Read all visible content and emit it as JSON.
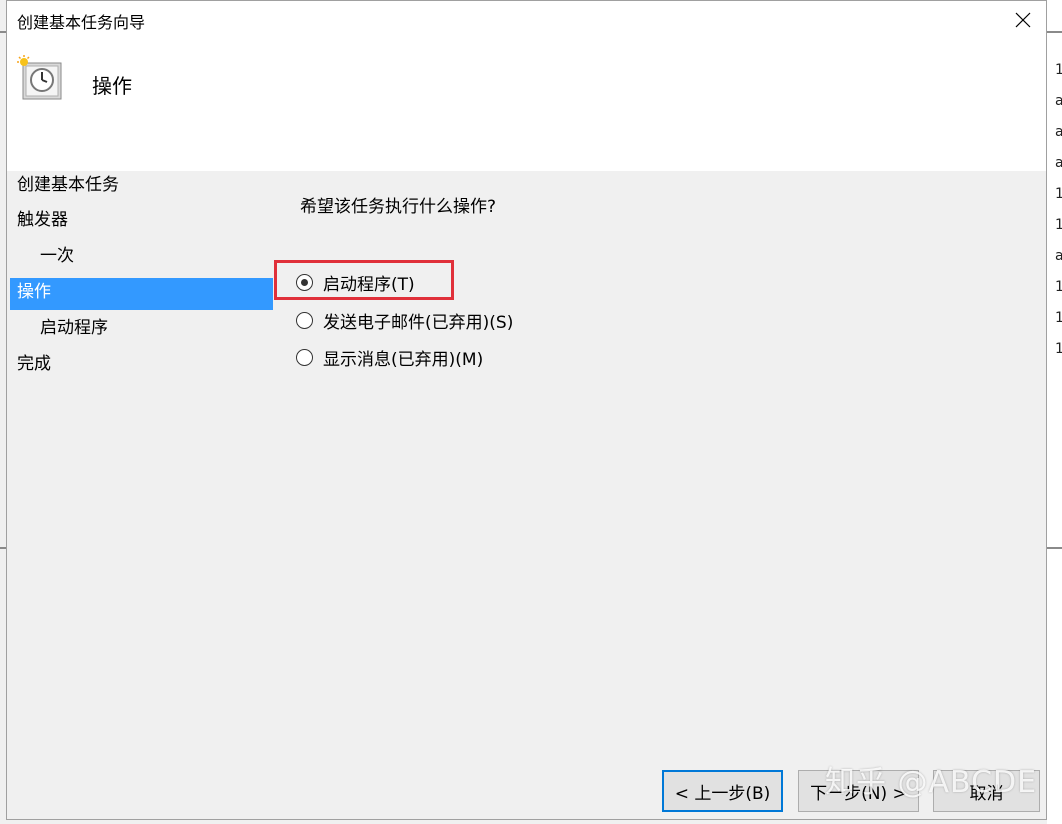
{
  "window": {
    "title": "创建基本任务向导",
    "close_glyph": "✕"
  },
  "header": {
    "title": "操作",
    "icon": "task-clock-icon"
  },
  "nav": {
    "items": [
      {
        "label": "创建基本任务"
      },
      {
        "label": "触发器"
      },
      {
        "label": "一次"
      },
      {
        "label": "操作"
      },
      {
        "label": "启动程序"
      },
      {
        "label": "完成"
      }
    ]
  },
  "main": {
    "question": "希望该任务执行什么操作?",
    "options": [
      {
        "label": "启动程序(T)",
        "checked": true
      },
      {
        "label": "发送电子邮件(已弃用)(S)",
        "checked": false
      },
      {
        "label": "显示消息(已弃用)(M)",
        "checked": false
      }
    ]
  },
  "buttons": {
    "back": "< 上一步(B)",
    "next": "下一步(N) >",
    "cancel": "取消"
  },
  "watermark": "知乎 @ABCDE",
  "background": {
    "right_glyphs": [
      "1",
      "a",
      "a",
      "a",
      "1",
      "1",
      "a",
      "1",
      "1",
      "1"
    ]
  },
  "colors": {
    "selection": "#3399ff",
    "highlight_box": "#e0303a",
    "default_button_border": "#0078d7"
  }
}
